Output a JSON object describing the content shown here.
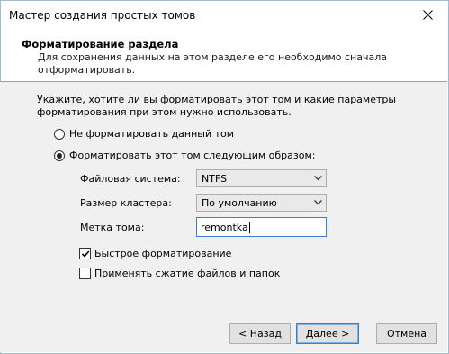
{
  "window": {
    "title": "Мастер создания простых томов"
  },
  "header": {
    "title": "Форматирование раздела",
    "subtitle": "Для сохранения данных на этом разделе его необходимо сначала отформатировать."
  },
  "body": {
    "intro": "Укажите, хотите ли вы форматировать этот том и какие параметры форматирования при этом нужно использовать.",
    "options": {
      "no_format": "Не форматировать данный том",
      "format": "Форматировать этот том следующим образом:"
    },
    "fields": {
      "filesystem_label": "Файловая система:",
      "filesystem_value": "NTFS",
      "cluster_label": "Размер кластера:",
      "cluster_value": "По умолчанию",
      "volume_label": "Метка тома:",
      "volume_value": "remontka"
    },
    "checks": {
      "quick_format": "Быстрое форматирование",
      "compression": "Применять сжатие файлов и папок"
    }
  },
  "footer": {
    "back": "< Назад",
    "next": "Далее >",
    "cancel": "Отмена"
  }
}
